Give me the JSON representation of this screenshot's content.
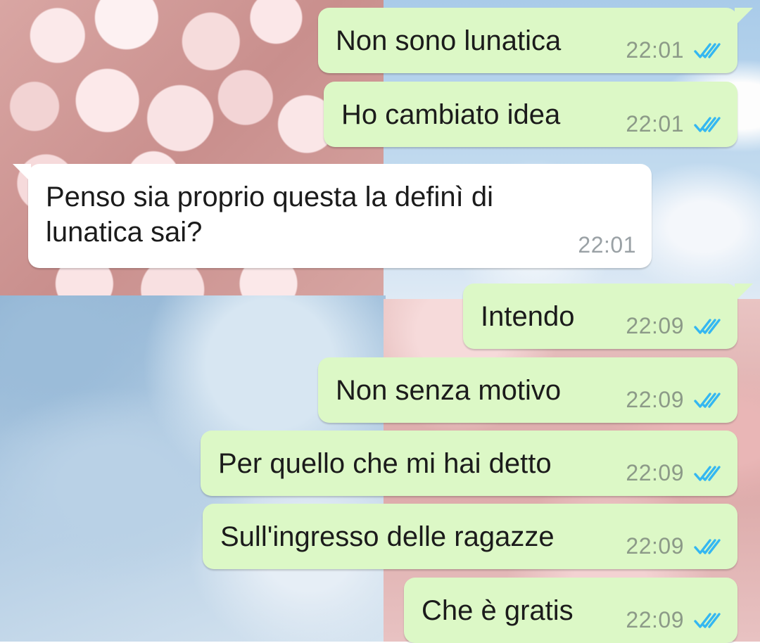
{
  "colors": {
    "outgoing_bubble": "#dcf8c6",
    "incoming_bubble": "#ffffff",
    "read_tick": "#34b7f1",
    "timestamp": "#8c9a88"
  },
  "messages": [
    {
      "direction": "out",
      "text": "Non sono lunatica",
      "time": "22:01",
      "status": "read-double-check-icon"
    },
    {
      "direction": "out",
      "text": "Ho cambiato idea",
      "time": "22:01",
      "status": "read-double-check-icon"
    },
    {
      "direction": "in",
      "text": "Penso sia proprio questa la definì di lunatica sai?",
      "time": "22:01"
    },
    {
      "direction": "out",
      "text": "Intendo",
      "time": "22:09",
      "status": "read-double-check-icon"
    },
    {
      "direction": "out",
      "text": "Non senza motivo",
      "time": "22:09",
      "status": "read-double-check-icon"
    },
    {
      "direction": "out",
      "text": "Per quello che mi hai detto",
      "time": "22:09",
      "status": "read-double-check-icon"
    },
    {
      "direction": "out",
      "text": "Sull'ingresso delle ragazze",
      "time": "22:09",
      "status": "read-double-check-icon"
    },
    {
      "direction": "out",
      "text": "Che è gratis",
      "time": "22:09",
      "status": "read-double-check-icon"
    }
  ]
}
